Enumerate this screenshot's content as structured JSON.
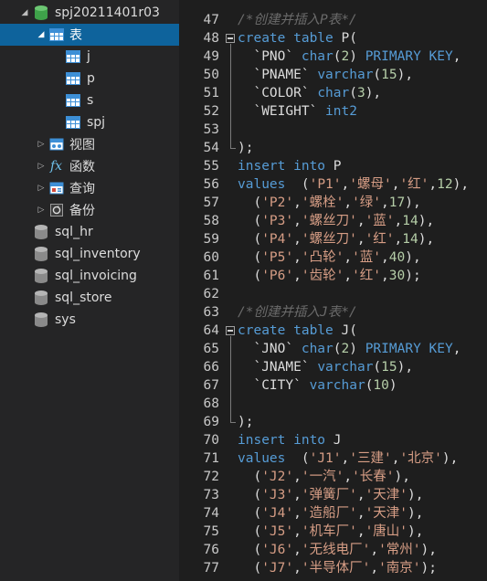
{
  "tree": {
    "db_name": "spj20211401r03",
    "tables_folder": "表",
    "tables": [
      "j",
      "p",
      "s",
      "spj"
    ],
    "views": "视图",
    "functions": "函数",
    "queries": "查询",
    "backups": "备份",
    "other_dbs": [
      "sql_hr",
      "sql_inventory",
      "sql_invoicing",
      "sql_store",
      "sys"
    ]
  },
  "colors": {
    "keyword": "#569cd6",
    "string": "#d69d85",
    "number": "#b5cea8",
    "comment": "#6a6a6a",
    "selection": "#0e639c"
  },
  "editor": {
    "lines": [
      {
        "n": "47",
        "tokens": [
          {
            "c": "cm",
            "t": "/*创建并插入P表*/"
          }
        ]
      },
      {
        "n": "48",
        "fold": true,
        "tokens": [
          {
            "c": "kw",
            "t": "create table "
          },
          {
            "c": "id",
            "t": "P("
          }
        ]
      },
      {
        "n": "49",
        "tokens": [
          {
            "c": "id",
            "t": "  `PNO` "
          },
          {
            "c": "kw",
            "t": "char"
          },
          {
            "c": "id",
            "t": "("
          },
          {
            "c": "num",
            "t": "2"
          },
          {
            "c": "id",
            "t": ") "
          },
          {
            "c": "kw",
            "t": "PRIMARY KEY"
          },
          {
            "c": "id",
            "t": ","
          }
        ]
      },
      {
        "n": "50",
        "tokens": [
          {
            "c": "id",
            "t": "  `PNAME` "
          },
          {
            "c": "kw",
            "t": "varchar"
          },
          {
            "c": "id",
            "t": "("
          },
          {
            "c": "num",
            "t": "15"
          },
          {
            "c": "id",
            "t": "),"
          }
        ]
      },
      {
        "n": "51",
        "tokens": [
          {
            "c": "id",
            "t": "  `COLOR` "
          },
          {
            "c": "kw",
            "t": "char"
          },
          {
            "c": "id",
            "t": "("
          },
          {
            "c": "num",
            "t": "3"
          },
          {
            "c": "id",
            "t": "),"
          }
        ]
      },
      {
        "n": "52",
        "tokens": [
          {
            "c": "id",
            "t": "  `WEIGHT` "
          },
          {
            "c": "kw",
            "t": "int2"
          }
        ]
      },
      {
        "n": "53",
        "tokens": []
      },
      {
        "n": "54",
        "foldend": true,
        "tokens": [
          {
            "c": "id",
            "t": ");"
          }
        ]
      },
      {
        "n": "55",
        "tokens": [
          {
            "c": "kw",
            "t": "insert into "
          },
          {
            "c": "id",
            "t": "P"
          }
        ]
      },
      {
        "n": "56",
        "tokens": [
          {
            "c": "kw",
            "t": "values"
          },
          {
            "c": "id",
            "t": "  ("
          },
          {
            "c": "str",
            "t": "'P1'"
          },
          {
            "c": "id",
            "t": ","
          },
          {
            "c": "str",
            "t": "'螺母'"
          },
          {
            "c": "id",
            "t": ","
          },
          {
            "c": "str",
            "t": "'红'"
          },
          {
            "c": "id",
            "t": ","
          },
          {
            "c": "num",
            "t": "12"
          },
          {
            "c": "id",
            "t": "),"
          }
        ]
      },
      {
        "n": "57",
        "tokens": [
          {
            "c": "id",
            "t": "  ("
          },
          {
            "c": "str",
            "t": "'P2'"
          },
          {
            "c": "id",
            "t": ","
          },
          {
            "c": "str",
            "t": "'螺栓'"
          },
          {
            "c": "id",
            "t": ","
          },
          {
            "c": "str",
            "t": "'绿'"
          },
          {
            "c": "id",
            "t": ","
          },
          {
            "c": "num",
            "t": "17"
          },
          {
            "c": "id",
            "t": "),"
          }
        ]
      },
      {
        "n": "58",
        "tokens": [
          {
            "c": "id",
            "t": "  ("
          },
          {
            "c": "str",
            "t": "'P3'"
          },
          {
            "c": "id",
            "t": ","
          },
          {
            "c": "str",
            "t": "'螺丝刀'"
          },
          {
            "c": "id",
            "t": ","
          },
          {
            "c": "str",
            "t": "'蓝'"
          },
          {
            "c": "id",
            "t": ","
          },
          {
            "c": "num",
            "t": "14"
          },
          {
            "c": "id",
            "t": "),"
          }
        ]
      },
      {
        "n": "59",
        "tokens": [
          {
            "c": "id",
            "t": "  ("
          },
          {
            "c": "str",
            "t": "'P4'"
          },
          {
            "c": "id",
            "t": ","
          },
          {
            "c": "str",
            "t": "'螺丝刀'"
          },
          {
            "c": "id",
            "t": ","
          },
          {
            "c": "str",
            "t": "'红'"
          },
          {
            "c": "id",
            "t": ","
          },
          {
            "c": "num",
            "t": "14"
          },
          {
            "c": "id",
            "t": "),"
          }
        ]
      },
      {
        "n": "60",
        "tokens": [
          {
            "c": "id",
            "t": "  ("
          },
          {
            "c": "str",
            "t": "'P5'"
          },
          {
            "c": "id",
            "t": ","
          },
          {
            "c": "str",
            "t": "'凸轮'"
          },
          {
            "c": "id",
            "t": ","
          },
          {
            "c": "str",
            "t": "'蓝'"
          },
          {
            "c": "id",
            "t": ","
          },
          {
            "c": "num",
            "t": "40"
          },
          {
            "c": "id",
            "t": "),"
          }
        ]
      },
      {
        "n": "61",
        "tokens": [
          {
            "c": "id",
            "t": "  ("
          },
          {
            "c": "str",
            "t": "'P6'"
          },
          {
            "c": "id",
            "t": ","
          },
          {
            "c": "str",
            "t": "'齿轮'"
          },
          {
            "c": "id",
            "t": ","
          },
          {
            "c": "str",
            "t": "'红'"
          },
          {
            "c": "id",
            "t": ","
          },
          {
            "c": "num",
            "t": "30"
          },
          {
            "c": "id",
            "t": ");"
          }
        ]
      },
      {
        "n": "62",
        "tokens": []
      },
      {
        "n": "63",
        "tokens": [
          {
            "c": "cm",
            "t": "/*创建并插入J表*/"
          }
        ]
      },
      {
        "n": "64",
        "fold": true,
        "tokens": [
          {
            "c": "kw",
            "t": "create table "
          },
          {
            "c": "id",
            "t": "J("
          }
        ]
      },
      {
        "n": "65",
        "tokens": [
          {
            "c": "id",
            "t": "  `JNO` "
          },
          {
            "c": "kw",
            "t": "char"
          },
          {
            "c": "id",
            "t": "("
          },
          {
            "c": "num",
            "t": "2"
          },
          {
            "c": "id",
            "t": ") "
          },
          {
            "c": "kw",
            "t": "PRIMARY KEY"
          },
          {
            "c": "id",
            "t": ","
          }
        ]
      },
      {
        "n": "66",
        "tokens": [
          {
            "c": "id",
            "t": "  `JNAME` "
          },
          {
            "c": "kw",
            "t": "varchar"
          },
          {
            "c": "id",
            "t": "("
          },
          {
            "c": "num",
            "t": "15"
          },
          {
            "c": "id",
            "t": "),"
          }
        ]
      },
      {
        "n": "67",
        "tokens": [
          {
            "c": "id",
            "t": "  `CITY` "
          },
          {
            "c": "kw",
            "t": "varchar"
          },
          {
            "c": "id",
            "t": "("
          },
          {
            "c": "num",
            "t": "10"
          },
          {
            "c": "id",
            "t": ")"
          }
        ]
      },
      {
        "n": "68",
        "tokens": []
      },
      {
        "n": "69",
        "foldend": true,
        "tokens": [
          {
            "c": "id",
            "t": ");"
          }
        ]
      },
      {
        "n": "70",
        "tokens": [
          {
            "c": "kw",
            "t": "insert into "
          },
          {
            "c": "id",
            "t": "J"
          }
        ]
      },
      {
        "n": "71",
        "tokens": [
          {
            "c": "kw",
            "t": "values"
          },
          {
            "c": "id",
            "t": "  ("
          },
          {
            "c": "str",
            "t": "'J1'"
          },
          {
            "c": "id",
            "t": ","
          },
          {
            "c": "str",
            "t": "'三建'"
          },
          {
            "c": "id",
            "t": ","
          },
          {
            "c": "str",
            "t": "'北京'"
          },
          {
            "c": "id",
            "t": "),"
          }
        ]
      },
      {
        "n": "72",
        "tokens": [
          {
            "c": "id",
            "t": "  ("
          },
          {
            "c": "str",
            "t": "'J2'"
          },
          {
            "c": "id",
            "t": ","
          },
          {
            "c": "str",
            "t": "'一汽'"
          },
          {
            "c": "id",
            "t": ","
          },
          {
            "c": "str",
            "t": "'长春'"
          },
          {
            "c": "id",
            "t": "),"
          }
        ]
      },
      {
        "n": "73",
        "tokens": [
          {
            "c": "id",
            "t": "  ("
          },
          {
            "c": "str",
            "t": "'J3'"
          },
          {
            "c": "id",
            "t": ","
          },
          {
            "c": "str",
            "t": "'弹簧厂'"
          },
          {
            "c": "id",
            "t": ","
          },
          {
            "c": "str",
            "t": "'天津'"
          },
          {
            "c": "id",
            "t": "),"
          }
        ]
      },
      {
        "n": "74",
        "tokens": [
          {
            "c": "id",
            "t": "  ("
          },
          {
            "c": "str",
            "t": "'J4'"
          },
          {
            "c": "id",
            "t": ","
          },
          {
            "c": "str",
            "t": "'造船厂'"
          },
          {
            "c": "id",
            "t": ","
          },
          {
            "c": "str",
            "t": "'天津'"
          },
          {
            "c": "id",
            "t": "),"
          }
        ]
      },
      {
        "n": "75",
        "tokens": [
          {
            "c": "id",
            "t": "  ("
          },
          {
            "c": "str",
            "t": "'J5'"
          },
          {
            "c": "id",
            "t": ","
          },
          {
            "c": "str",
            "t": "'机车厂'"
          },
          {
            "c": "id",
            "t": ","
          },
          {
            "c": "str",
            "t": "'唐山'"
          },
          {
            "c": "id",
            "t": "),"
          }
        ]
      },
      {
        "n": "76",
        "tokens": [
          {
            "c": "id",
            "t": "  ("
          },
          {
            "c": "str",
            "t": "'J6'"
          },
          {
            "c": "id",
            "t": ","
          },
          {
            "c": "str",
            "t": "'无线电厂'"
          },
          {
            "c": "id",
            "t": ","
          },
          {
            "c": "str",
            "t": "'常州'"
          },
          {
            "c": "id",
            "t": "),"
          }
        ]
      },
      {
        "n": "77",
        "tokens": [
          {
            "c": "id",
            "t": "  ("
          },
          {
            "c": "str",
            "t": "'J7'"
          },
          {
            "c": "id",
            "t": ","
          },
          {
            "c": "str",
            "t": "'半导体厂'"
          },
          {
            "c": "id",
            "t": ","
          },
          {
            "c": "str",
            "t": "'南京'"
          },
          {
            "c": "id",
            "t": ");"
          }
        ]
      }
    ]
  }
}
